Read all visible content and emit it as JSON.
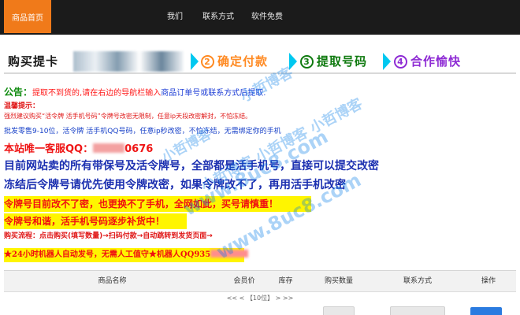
{
  "nav": {
    "home": "商品首页",
    "about": "我们",
    "contact": "联系方式",
    "software": "软件免费"
  },
  "steps": {
    "step1": "购买提卡",
    "step2_num": "2",
    "step2": "确定付款",
    "step3_num": "3",
    "step3": "提取号码",
    "step4_num": "4",
    "step4": "合作愉快"
  },
  "notice": {
    "announcement_label": "公告：",
    "announcement_text": "提取不到货的,请在右边的导航栏输入",
    "announcement_tail": "商品订单号或联系方式后提取.",
    "tip": "温馨提示：",
    "advice": "强烈建议购买“活令牌 活手机号码”令牌号改密无限制，任意ip天段改密解封，不怕冻结。",
    "batch": "批发零售9-10位，活令牌 活手机QQ号码，任意ip秒改密，不怕冻结，无需绑定你的手机",
    "qq_prefix": "本站唯一客服QQ：",
    "qq_suffix": "0676",
    "big_line1": "目前网站卖的所有带保号及活令牌号，全部都是活手机号，直接可以提交改密",
    "big_line2": "冻结后令牌号请优先使用令牌改密，如果令牌改不了，再用活手机改密",
    "highlight1": "令牌号目前改不了密，也更换不了手机，全网如此，买号请慎重！",
    "highlight2": "令牌号和谐，活手机号码逐步补货中！",
    "flow": "购买流程：点击购买(填写数量)→扫码付款→自动跳转到发货页面→",
    "auto_prefix": "★24小时机器人自动发号，无需人工值守★机器人QQ935"
  },
  "watermark": {
    "line1": "小哲博客",
    "line2": "小哲博客",
    "line3": "小哲博客 小哲博客 小哲博客",
    "line4": "www.8uc8.com",
    "line5": "www.8uc8.com"
  },
  "table": {
    "headers": [
      "商品名称",
      "会员价",
      "库存",
      "购买数量",
      "联系方式",
      "操作"
    ],
    "pager": "<< < 【10位】 > >>"
  },
  "colors": {
    "nav_bg": "#1b1b1b",
    "nav_active": "#f07a1a",
    "step2": "#ff8a22",
    "step3": "#0f7a0f",
    "step4": "#8e2bd4",
    "arrow": "#00c8f0",
    "notice_red": "#ef1515",
    "notice_blue": "#1b2fb0",
    "highlight_bg": "#fff500"
  }
}
